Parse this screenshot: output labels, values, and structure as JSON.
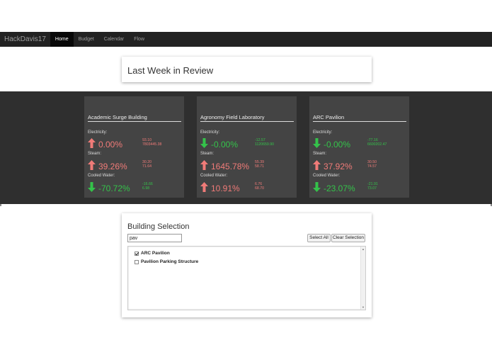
{
  "navbar": {
    "brand": "HackDavis17",
    "items": [
      {
        "label": "Home"
      },
      {
        "label": "Budget"
      },
      {
        "label": "Calendar"
      },
      {
        "label": "Flow"
      }
    ]
  },
  "review": {
    "title": "Last Week in Review"
  },
  "labels": {
    "electricity": "Electricity:",
    "steam": "Steam:",
    "cooled_water": "Cooled Water:"
  },
  "buildings": [
    {
      "name": "Academic Surge Building",
      "electricity": {
        "pct": "0.00%",
        "direction": "up",
        "line1": "93.10",
        "line2": "7803445.38"
      },
      "steam": {
        "pct": "39.26%",
        "direction": "up",
        "line1": "30.20",
        "line2": "71.64"
      },
      "cooled_water": {
        "pct": "-70.72%",
        "direction": "down",
        "line1": "-16.66",
        "line2": "6.98"
      }
    },
    {
      "name": "Agronomy Field Laboratory",
      "electricity": {
        "pct": "-0.00%",
        "direction": "down",
        "line1": "-12.57",
        "line2": "1120659.90"
      },
      "steam": {
        "pct": "1645.78%",
        "direction": "up",
        "line1": "55.39",
        "line2": "58.71"
      },
      "cooled_water": {
        "pct": "10.91%",
        "direction": "up",
        "line1": "6.76",
        "line2": "68.70"
      }
    },
    {
      "name": "ARC Pavilion",
      "electricity": {
        "pct": "-0.00%",
        "direction": "down",
        "line1": "-77.16",
        "line2": "6600202.47"
      },
      "steam": {
        "pct": "37.92%",
        "direction": "up",
        "line1": "30.50",
        "line2": "74.57"
      },
      "cooled_water": {
        "pct": "-23.07%",
        "direction": "down",
        "line1": "-21.91",
        "line2": "73.07"
      }
    }
  ],
  "colors": {
    "up": "#f07b78",
    "down": "#34c24a"
  },
  "selection": {
    "title": "Building Selection",
    "search_value": "pav",
    "select_all": "Select All",
    "clear_selection": "Clear Selection",
    "options": [
      {
        "label": "ARC Pavilion",
        "checked": true
      },
      {
        "label": "Pavilion Parking Structure",
        "checked": false
      }
    ]
  }
}
